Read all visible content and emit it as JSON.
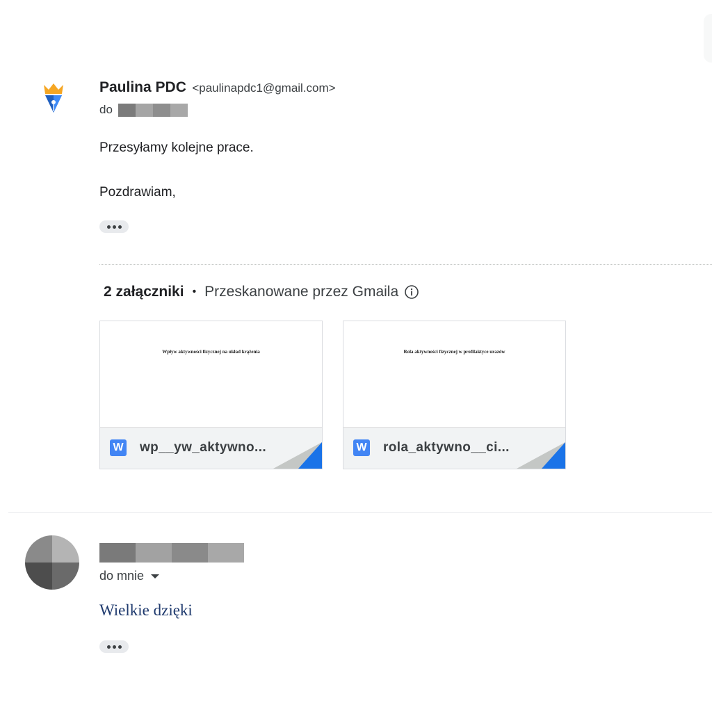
{
  "message1": {
    "sender_name": "Paulina PDC",
    "sender_email": "<paulinapdc1@gmail.com>",
    "to_label": "do",
    "body_line1": "Przesyłamy kolejne prace.",
    "body_line2": "Pozdrawiam,",
    "avatar_icon": "pen-nib-crown-icon"
  },
  "attachments": {
    "count_label": "2 załączniki",
    "bullet": "•",
    "scanned_label": "Przeskanowane przez Gmaila",
    "items": [
      {
        "preview_title": "Wpływ aktywności fizycznej na układ krążenia",
        "file_name": "wp__yw_aktywno...",
        "type_icon": "W"
      },
      {
        "preview_title": "Rola aktywności fizycznej w profilaktyce urazów",
        "file_name": "rola_aktywno__ci...",
        "type_icon": "W"
      }
    ]
  },
  "message2": {
    "to_label": "do mnie",
    "body": "Wielkie dzięki"
  },
  "colors": {
    "word_blue": "#4285f4",
    "fold_blue": "#1a73e8",
    "reply_text": "#1f3a6e"
  }
}
